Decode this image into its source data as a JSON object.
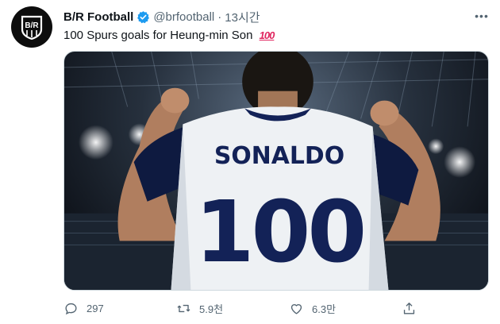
{
  "tweet": {
    "author_name": "B/R Football",
    "handle": "@brfootball",
    "separator": "·",
    "time": "13시간",
    "text": "100 Spurs goals for Heung-min Son",
    "emoji": "100",
    "logo_text": "B/R"
  },
  "media": {
    "jersey_name": "SONALDO",
    "jersey_number": "100"
  },
  "actions": {
    "reply_count": "297",
    "retweet_count": "5.9천",
    "like_count": "6.3만"
  },
  "colors": {
    "verified": "#1d9bf0",
    "text_secondary": "#536471",
    "emoji_100": "#e0245e",
    "jersey_navy": "#132257"
  },
  "icons": [
    "verified-badge-icon",
    "more-icon",
    "reply-icon",
    "retweet-icon",
    "like-icon",
    "share-icon"
  ]
}
